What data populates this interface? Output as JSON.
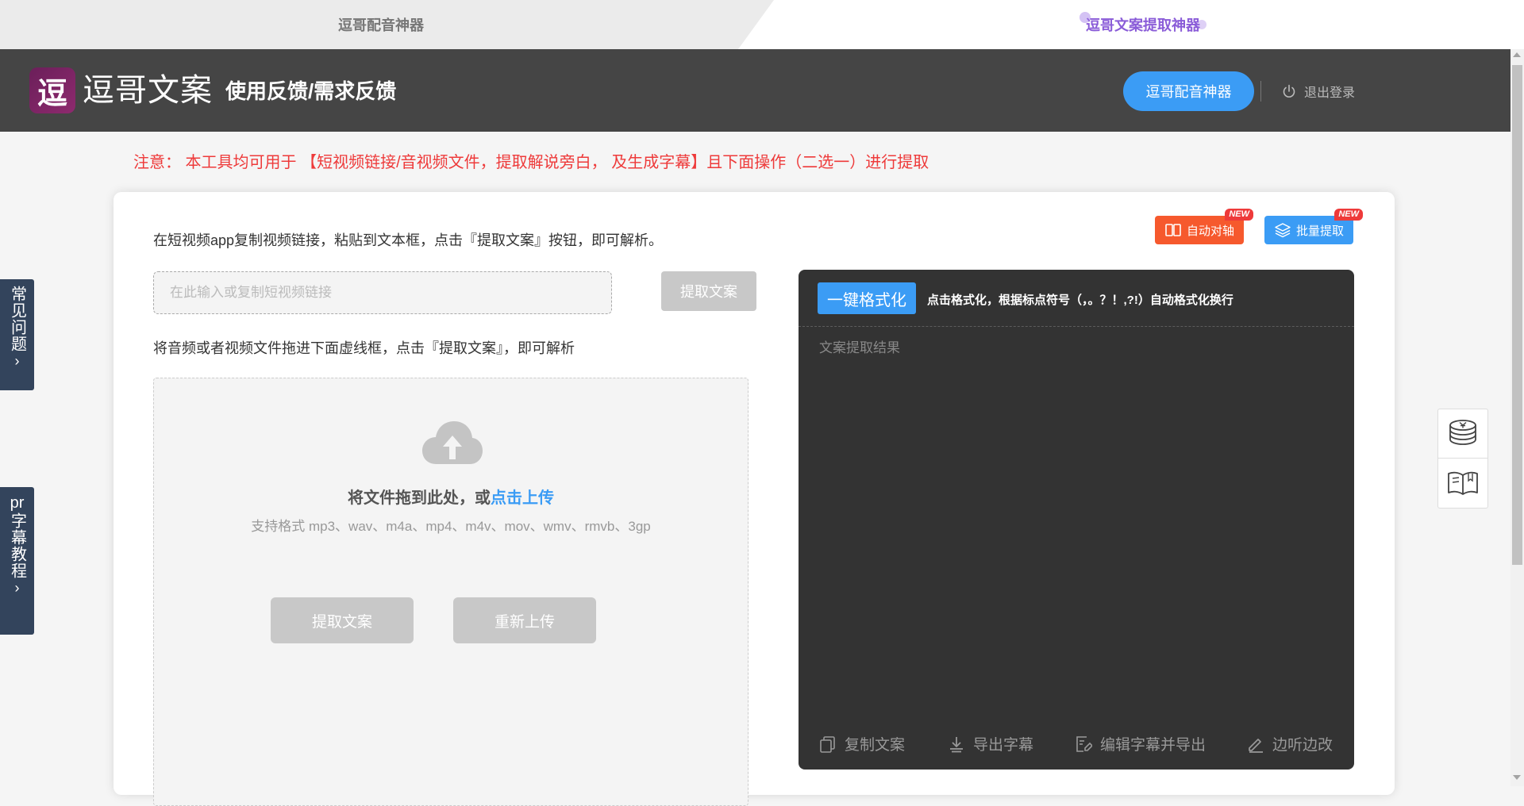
{
  "tabs": {
    "left_label": "逗哥配音神器",
    "right_label": "逗哥文案提取神器"
  },
  "header": {
    "logo_glyph": "逗",
    "logo_text": "逗哥文案",
    "feedback_label": "使用反馈/需求反馈",
    "dub_button_label": "逗哥配音神器",
    "logout_label": "退出登录"
  },
  "notice": "注意：  本工具均可用于 【短视频链接/音视频文件，提取解说旁白， 及生成字幕】且下面操作（二选一）进行提取",
  "side": {
    "faq_label": "常见问题",
    "pr_prefix": "pr",
    "pr_label": "字幕教程",
    "chevron": "›"
  },
  "link_section": {
    "instruction": "在短视频app复制视频链接，粘贴到文本框，点击『提取文案』按钮，即可解析。",
    "placeholder": "在此输入或复制短视频链接",
    "extract_label": "提取文案"
  },
  "file_section": {
    "instruction": "将音频或者视频文件拖进下面虚线框，点击『提取文案』，即可解析",
    "drop_text": "将文件拖到此处，或",
    "drop_link": "点击上传",
    "formats": "支持格式 mp3、wav、m4a、mp4、m4v、mov、wmv、rmvb、3gp",
    "extract_label": "提取文案",
    "reupload_label": "重新上传"
  },
  "feature_buttons": {
    "align_label": "自动对轴",
    "batch_label": "批量提取",
    "new_tag": "NEW"
  },
  "result_panel": {
    "format_label": "一键格式化",
    "format_hint": "点击格式化，根据标点符号（，。？！,?!）自动格式化换行",
    "placeholder": "文案提取结果",
    "copy_label": "复制文案",
    "export_label": "导出字幕",
    "edit_export_label": "编辑字幕并导出",
    "listen_edit_label": "边听边改"
  },
  "icons": {
    "logout": "power-icon",
    "cloud": "cloud-upload-icon",
    "align": "book-open-icon",
    "batch": "layers-icon",
    "copy": "copy-icon",
    "export": "download-icon",
    "edit": "edit-doc-icon",
    "listen": "pencil-icon",
    "coins": "coins-icon",
    "book": "book-icon"
  },
  "colors": {
    "header_bg": "#454545",
    "accent_blue": "#3b9cf5",
    "notice_red": "#ee3a3a",
    "align_orange": "#f6592d",
    "panel_dark": "#333333",
    "side_navy": "#33445c"
  }
}
